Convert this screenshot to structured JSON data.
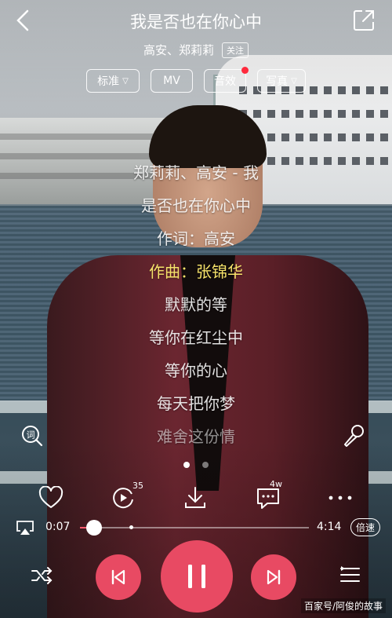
{
  "header": {
    "title": "我是否也在你心中",
    "artists": "高安、郑莉莉",
    "follow_label": "关注"
  },
  "chips": [
    {
      "label": "标准",
      "dropdown": true
    },
    {
      "label": "MV",
      "dropdown": false
    },
    {
      "label": "音效",
      "dropdown": false,
      "dot": true
    },
    {
      "label": "写真",
      "dropdown": true
    }
  ],
  "lyrics": [
    {
      "text": "郑莉莉、高安 - 我",
      "state": "normal"
    },
    {
      "text": "是否也在你心中",
      "state": "normal"
    },
    {
      "text": "作词：高安",
      "state": "normal"
    },
    {
      "text": "作曲：张锦华",
      "state": "active"
    },
    {
      "text": "默默的等",
      "state": "normal"
    },
    {
      "text": "等你在红尘中",
      "state": "normal"
    },
    {
      "text": "等你的心",
      "state": "normal"
    },
    {
      "text": "每天把你梦",
      "state": "normal"
    },
    {
      "text": "难舍这份情",
      "state": "fade"
    }
  ],
  "actions": {
    "comment_loop_count": "35",
    "comment_count": "4w"
  },
  "progress": {
    "current": "0:07",
    "total": "4:14",
    "played_fraction": 0.028,
    "speed_label": "倍速"
  },
  "watermark": "百家号/阿俊的故事",
  "colors": {
    "accent": "#e84a63",
    "highlight_lyric": "#f5e26a",
    "notification_dot": "#ff2a3d"
  }
}
